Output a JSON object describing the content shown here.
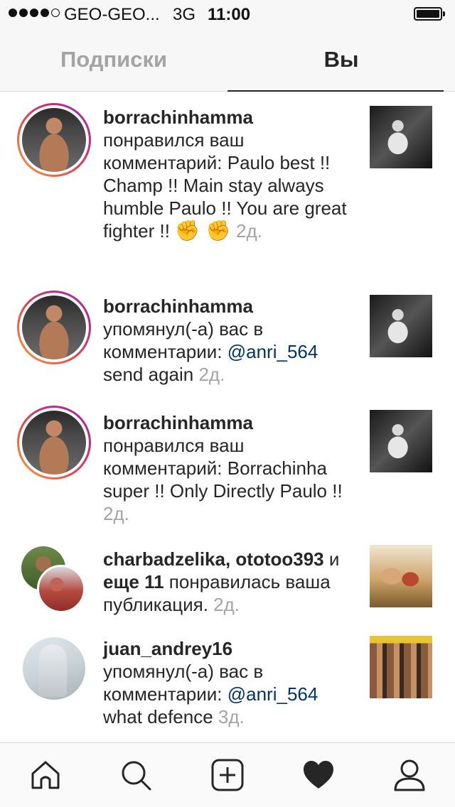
{
  "status_bar": {
    "carrier": "GEO-GEO...",
    "network": "3G",
    "time": "11:00"
  },
  "tabs": {
    "following": "Подписки",
    "you": "Вы"
  },
  "notifications": [
    {
      "user": "borrachinhamma",
      "text": " понравился ваш комментарий: Paulo best !! Champ !! Main stay always humble Paulo !! You are great fighter !! ",
      "emoji": "✊ ✊",
      "time": "2д."
    },
    {
      "user": "borrachinhamma",
      "text": " упомянул(-а) вас в комментарии: ",
      "mention": "@anri_564",
      "text2": " send again",
      "time": "2д."
    },
    {
      "user": "borrachinhamma",
      "text": " понравился ваш комментарий: Borrachinha super !! Only Directly Paulo !!",
      "time": "2д."
    },
    {
      "user": "charbadzelika, ototoo393",
      "text": " и ",
      "bold2": "еще 11",
      "text2": " понравилась ваша публикация.",
      "time": "2д."
    },
    {
      "user": "juan_andrey16",
      "text": " упомянул(-а) вас в комментарии: ",
      "mention": "@anri_564",
      "text2": " what defence",
      "time": "3д."
    }
  ],
  "colors": {
    "mention": "#003569",
    "muted": "#a4a4a4",
    "text": "#262626"
  }
}
